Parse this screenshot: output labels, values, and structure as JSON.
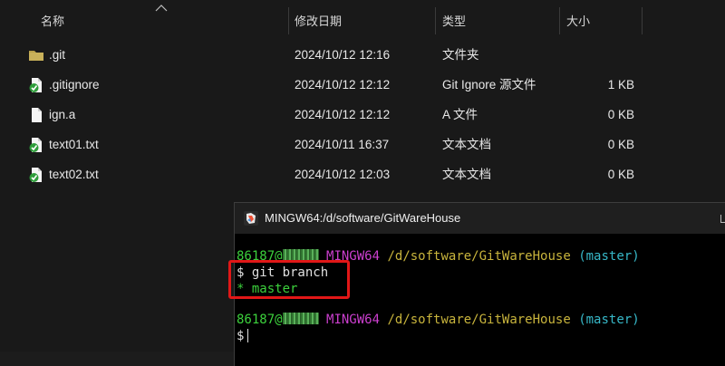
{
  "columns": {
    "name": "名称",
    "modified": "修改日期",
    "type": "类型",
    "size": "大小"
  },
  "files": [
    {
      "name": ".git",
      "modified": "2024/10/12 12:16",
      "type": "文件夹",
      "size": "",
      "icon": "folder-icon"
    },
    {
      "name": ".gitignore",
      "modified": "2024/10/12 12:12",
      "type": "Git Ignore 源文件",
      "size": "1 KB",
      "icon": "git-tracked-file-icon"
    },
    {
      "name": "ign.a",
      "modified": "2024/10/12 12:12",
      "type": "A 文件",
      "size": "0 KB",
      "icon": "file-icon"
    },
    {
      "name": "text01.txt",
      "modified": "2024/10/11 16:37",
      "type": "文本文档",
      "size": "0 KB",
      "icon": "git-tracked-file-icon"
    },
    {
      "name": "text02.txt",
      "modified": "2024/10/12 12:03",
      "type": "文本文档",
      "size": "0 KB",
      "icon": "git-tracked-file-icon"
    }
  ],
  "terminal": {
    "title": "MINGW64:/d/software/GitWareHouse",
    "prompt1": {
      "user": "86187@",
      "env": "MINGW64",
      "path": "/d/software/GitWareHouse",
      "branch": "(master)"
    },
    "command_line": "$ git branch",
    "output_line": "* master",
    "prompt2": {
      "user": "86187@",
      "env": "MINGW64",
      "path": "/d/software/GitWareHouse",
      "branch": "(master)"
    },
    "input_line": "$"
  },
  "colors": {
    "highlight": "#e11717",
    "prompt_user": "#3cd13c",
    "prompt_env": "#cc3fcf",
    "prompt_path": "#c8b43c",
    "prompt_branch": "#37b8c8"
  }
}
